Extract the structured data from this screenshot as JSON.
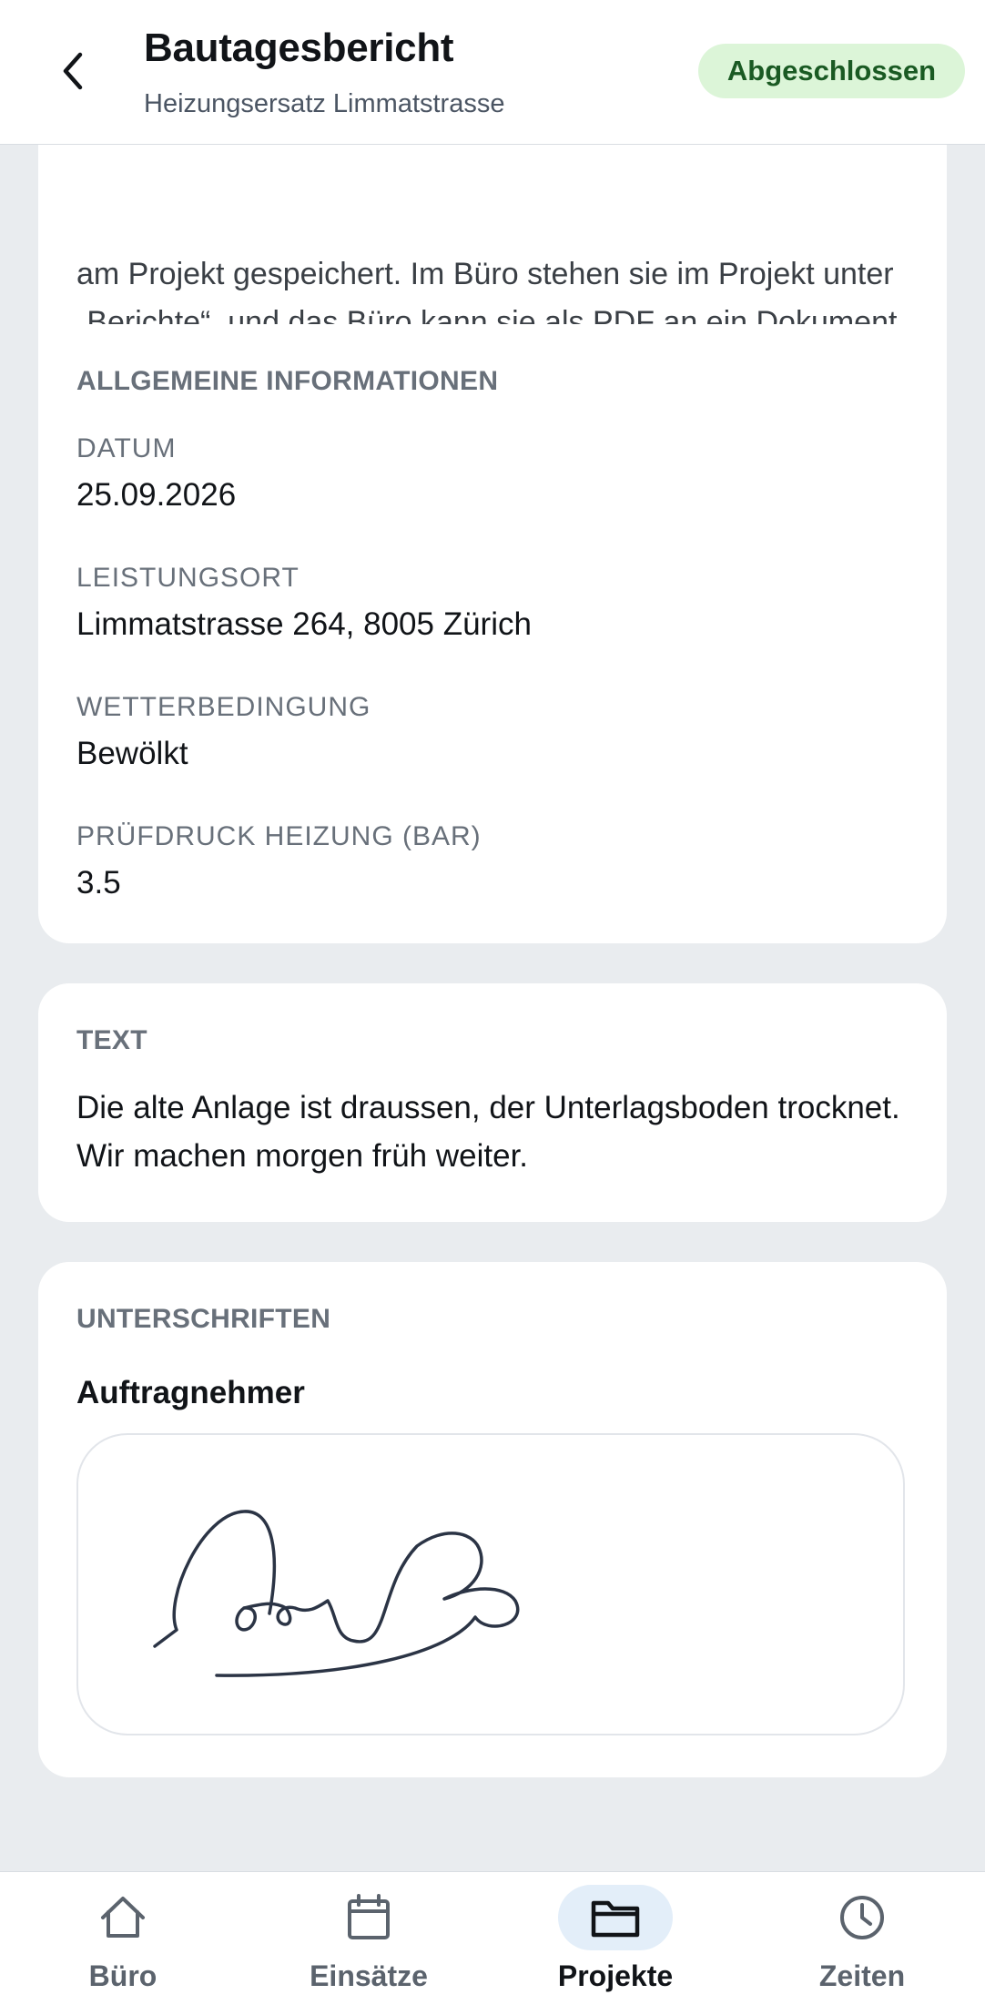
{
  "header": {
    "title": "Bautagesbericht",
    "subtitle": "Heizungsersatz Limmatstrasse",
    "status": "Abgeschlossen",
    "back_icon": "chevron-left-icon"
  },
  "intro": {
    "text": "am Projekt gespeichert. Im Büro stehen sie im Projekt unter „Berichte“, und das Büro kann sie als PDF an ein Dokument anhängen und mit ihm verschicken."
  },
  "info": {
    "title": "ALLGEMEINE INFORMATIONEN",
    "fields": [
      {
        "label": "DATUM",
        "value": "25.09.2026"
      },
      {
        "label": "LEISTUNGSORT",
        "value": "Limmatstrasse 264, 8005 Zürich"
      },
      {
        "label": "WETTERBEDINGUNG",
        "value": "Bewölkt"
      },
      {
        "label": "PRÜFDRUCK HEIZUNG (BAR)",
        "value": "3.5"
      }
    ]
  },
  "text_section": {
    "title": "TEXT",
    "body": "Die alte Anlage ist draussen, der Unterlagsboden trocknet. Wir machen morgen früh weiter."
  },
  "signatures": {
    "title": "UNTERSCHRIFTEN",
    "signer": "Auftragnehmer"
  },
  "tabs": [
    {
      "label": "Büro",
      "icon": "home-icon",
      "active": false
    },
    {
      "label": "Einsätze",
      "icon": "calendar-icon",
      "active": false
    },
    {
      "label": "Projekte",
      "icon": "folder-icon",
      "active": true
    },
    {
      "label": "Zeiten",
      "icon": "clock-icon",
      "active": false
    }
  ],
  "colors": {
    "accent": "#e3eef9",
    "status_bg": "#dcf5d8",
    "status_text": "#1a5a23",
    "background": "#e9ecef"
  }
}
